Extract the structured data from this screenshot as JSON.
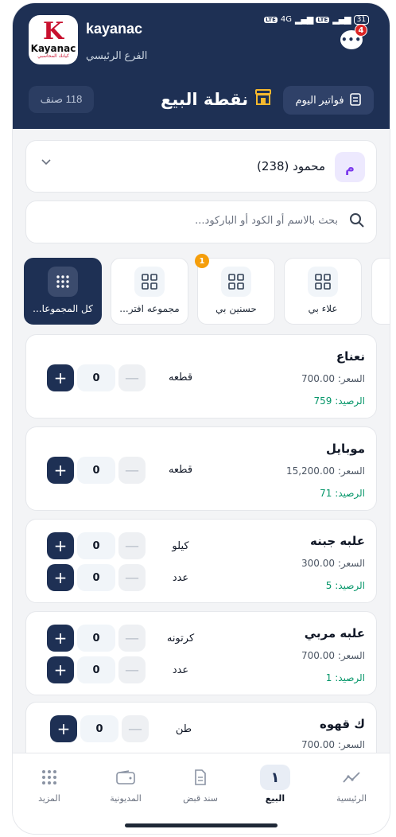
{
  "header": {
    "company": "kayanac",
    "branch": "الفرع الرئيسي",
    "logo_word": "Kayanac",
    "logo_tagline": "كيانك المحاسبي",
    "status": {
      "lte1": "LTE",
      "net": "4G",
      "lte2": "LTE",
      "battery": "31"
    },
    "chat_badge": "4",
    "items_count": "118 صنف",
    "title": "نقطة البيع",
    "today_invoices": "فواتير اليوم"
  },
  "customer": {
    "initial": "م",
    "name": "محمود (238)"
  },
  "search": {
    "placeholder": "بحث بالاسم أو الكود أو الباركود..."
  },
  "categories": [
    {
      "label": "علاء بي",
      "badge": ""
    },
    {
      "label": "حسنين بي",
      "badge": "1"
    },
    {
      "label": "مجموعه افتر...",
      "badge": ""
    },
    {
      "label": "كل المجموعا...",
      "badge": ""
    }
  ],
  "products": [
    {
      "name": "نعناع",
      "price": "السعر: 700.00",
      "stock": "الرصيد: 759",
      "units": [
        {
          "unit": "قطعه",
          "qty": "0"
        }
      ]
    },
    {
      "name": "موبايل",
      "price": "السعر: 15,200.00",
      "stock": "الرصيد: 71",
      "units": [
        {
          "unit": "قطعه",
          "qty": "0"
        }
      ]
    },
    {
      "name": "علبه جبنه",
      "price": "السعر: 300.00",
      "stock": "الرصيد: 5",
      "units": [
        {
          "unit": "كيلو",
          "qty": "0"
        },
        {
          "unit": "عدد",
          "qty": "0"
        }
      ]
    },
    {
      "name": "علبه مربي",
      "price": "السعر: 700.00",
      "stock": "الرصيد: 1",
      "units": [
        {
          "unit": "كرتونه",
          "qty": "0"
        },
        {
          "unit": "عدد",
          "qty": "0"
        }
      ]
    },
    {
      "name": "ك قهوه",
      "price": "السعر: 700.00",
      "stock": "",
      "units": [
        {
          "unit": "طن",
          "qty": "0"
        }
      ]
    }
  ],
  "stepper": {
    "plus": "+",
    "minus": "—"
  },
  "nav": [
    {
      "label": "الرئيسية",
      "icon": "chart-line-icon",
      "glyph": "〰"
    },
    {
      "label": "البيع",
      "icon": "sale-icon",
      "glyph": "١"
    },
    {
      "label": "سند قبض",
      "icon": "receipt-icon",
      "glyph": "🗎"
    },
    {
      "label": "المديونية",
      "icon": "wallet-icon",
      "glyph": "▭"
    },
    {
      "label": "المزيد",
      "icon": "grid-icon",
      "glyph": "⁞⁞⁞"
    }
  ],
  "colors": {
    "primary": "#1e3054",
    "accent": "#f59e0b",
    "stock": "#059669"
  }
}
